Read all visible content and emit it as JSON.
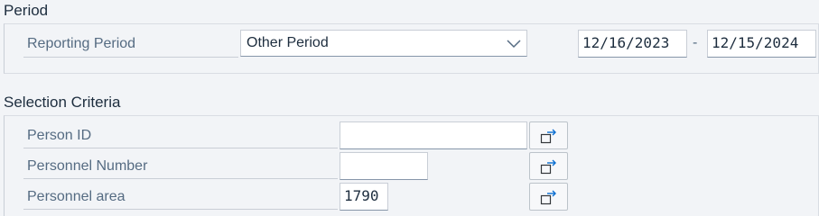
{
  "period_section": {
    "title": "Period",
    "reporting_period_label": "Reporting Period",
    "reporting_period_value": "Other Period",
    "date_from": "12/16/2023",
    "date_separator": "-",
    "date_to": "12/15/2024"
  },
  "selection_section": {
    "title": "Selection Criteria",
    "fields": [
      {
        "label": "Person ID",
        "value": "",
        "button_icon": "multiple-selection-icon"
      },
      {
        "label": "Personnel Number",
        "value": "",
        "button_icon": "multiple-selection-icon"
      },
      {
        "label": "Personnel area",
        "value": "1790",
        "button_icon": "multiple-selection-icon"
      }
    ]
  },
  "colors": {
    "background": "#f2f4f7",
    "label_text": "#556b82",
    "title_text": "#1d2d3e",
    "input_background": "#ffffff",
    "input_border": "#c9ced6",
    "icon_color": "#0a6ed1"
  }
}
